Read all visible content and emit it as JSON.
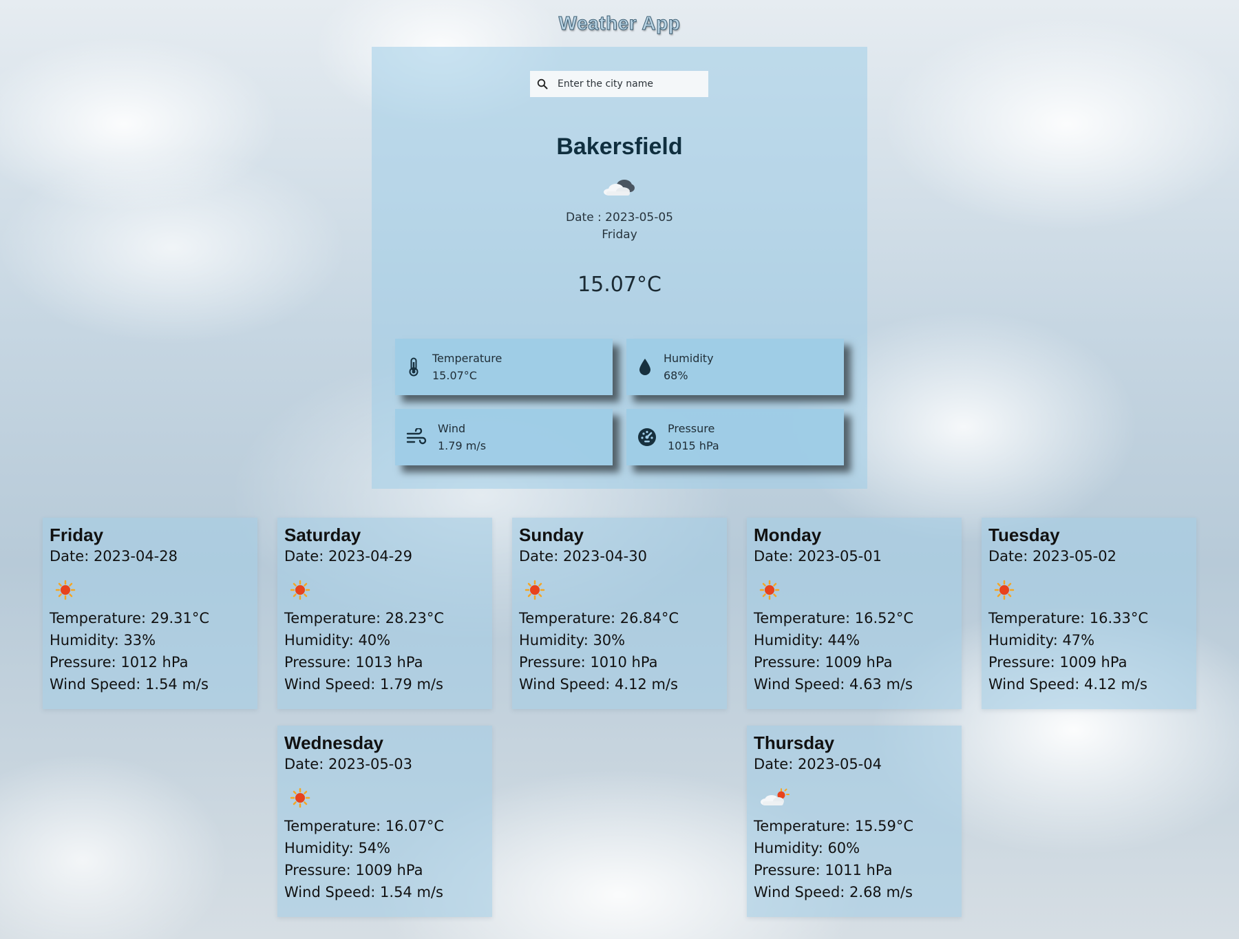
{
  "app": {
    "title": "Weather App"
  },
  "search": {
    "placeholder": "Enter the city name",
    "icon": "search-icon"
  },
  "current": {
    "city": "Bakersfield",
    "icon": "cloudy-icon",
    "date_text": "Date : 2023-05-05",
    "day": "Friday",
    "temperature": "15.07°C",
    "stats": {
      "temperature": {
        "label": "Temperature",
        "value": "15.07°C",
        "icon": "thermometer-icon"
      },
      "humidity": {
        "label": "Humidity",
        "value": "68%",
        "icon": "water-drop-icon"
      },
      "wind": {
        "label": "Wind",
        "value": "1.79 m/s",
        "icon": "wind-icon"
      },
      "pressure": {
        "label": "Pressure",
        "value": "1015 hPa",
        "icon": "gauge-icon"
      }
    }
  },
  "forecast": [
    {
      "day": "Friday",
      "date": "Date: 2023-04-28",
      "icon": "sun-icon",
      "temperature": "Temperature: 29.31°C",
      "humidity": "Humidity: 33%",
      "pressure": "Pressure: 1012 hPa",
      "wind": "Wind Speed: 1.54 m/s"
    },
    {
      "day": "Saturday",
      "date": "Date: 2023-04-29",
      "icon": "sun-icon",
      "temperature": "Temperature: 28.23°C",
      "humidity": "Humidity: 40%",
      "pressure": "Pressure: 1013 hPa",
      "wind": "Wind Speed: 1.79 m/s"
    },
    {
      "day": "Sunday",
      "date": "Date: 2023-04-30",
      "icon": "sun-icon",
      "temperature": "Temperature: 26.84°C",
      "humidity": "Humidity: 30%",
      "pressure": "Pressure: 1010 hPa",
      "wind": "Wind Speed: 4.12 m/s"
    },
    {
      "day": "Monday",
      "date": "Date: 2023-05-01",
      "icon": "sun-icon",
      "temperature": "Temperature: 16.52°C",
      "humidity": "Humidity: 44%",
      "pressure": "Pressure: 1009 hPa",
      "wind": "Wind Speed: 4.63 m/s"
    },
    {
      "day": "Tuesday",
      "date": "Date: 2023-05-02",
      "icon": "sun-icon",
      "temperature": "Temperature: 16.33°C",
      "humidity": "Humidity: 47%",
      "pressure": "Pressure: 1009 hPa",
      "wind": "Wind Speed: 4.12 m/s"
    },
    {
      "day": "Wednesday",
      "date": "Date: 2023-05-03",
      "icon": "sun-icon",
      "temperature": "Temperature: 16.07°C",
      "humidity": "Humidity: 54%",
      "pressure": "Pressure: 1009 hPa",
      "wind": "Wind Speed: 1.54 m/s"
    },
    {
      "day": "Thursday",
      "date": "Date: 2023-05-04",
      "icon": "partly-cloudy-icon",
      "temperature": "Temperature: 15.59°C",
      "humidity": "Humidity: 60%",
      "pressure": "Pressure: 1011 hPa",
      "wind": "Wind Speed: 2.68 m/s"
    }
  ],
  "colors": {
    "panel": "#a0cde8",
    "title_fill": "#b9d3e3",
    "title_stroke": "#3b5d72",
    "sun": "#e8421c",
    "sun_rays": "#f5a623"
  }
}
